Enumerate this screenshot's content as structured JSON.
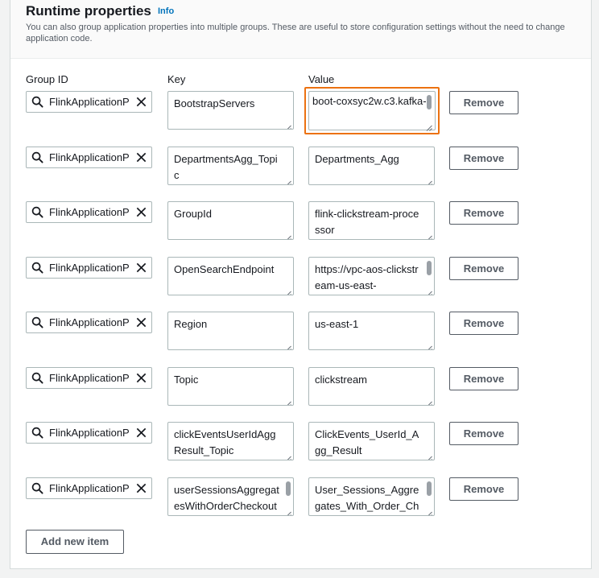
{
  "section": {
    "title": "Runtime properties",
    "info_label": "Info",
    "description": "You can also group application properties into multiple groups. These are useful to store configuration settings without the need to change application code."
  },
  "columns": {
    "group_id": "Group ID",
    "key": "Key",
    "value": "Value"
  },
  "rows": [
    {
      "group": "FlinkApplicationProperties",
      "key": "BootstrapServers",
      "value": "boot-coxsyc2w.c3.kafka-",
      "focused": true,
      "value_scroll": true,
      "key_scroll": false
    },
    {
      "group": "FlinkApplicationProperties",
      "key": "DepartmentsAgg_Topic",
      "value": "Departments_Agg",
      "focused": false,
      "value_scroll": false,
      "key_scroll": false
    },
    {
      "group": "FlinkApplicationProperties",
      "key": "GroupId",
      "value": "flink-clickstream-processor",
      "focused": false,
      "value_scroll": false,
      "key_scroll": false
    },
    {
      "group": "FlinkApplicationProperties",
      "key": "OpenSearchEndpoint",
      "value": "https://vpc-aos-clickstream-us-east-",
      "focused": false,
      "value_scroll": true,
      "key_scroll": false
    },
    {
      "group": "FlinkApplicationProperties",
      "key": "Region",
      "value": "us-east-1",
      "focused": false,
      "value_scroll": false,
      "key_scroll": false
    },
    {
      "group": "FlinkApplicationProperties",
      "key": "Topic",
      "value": "clickstream",
      "focused": false,
      "value_scroll": false,
      "key_scroll": false
    },
    {
      "group": "FlinkApplicationProperties",
      "key": "clickEventsUserIdAggResult_Topic",
      "value": "ClickEvents_UserId_Agg_Result",
      "focused": false,
      "value_scroll": false,
      "key_scroll": false
    },
    {
      "group": "FlinkApplicationProperties",
      "key": "userSessionsAggregatesWithOrderCheckout",
      "value": "User_Sessions_Aggregates_With_Order_Ch",
      "focused": false,
      "value_scroll": true,
      "key_scroll": true
    }
  ],
  "remove_label": "Remove",
  "add_label": "Add new item",
  "colors": {
    "focus": "#ec7211",
    "info": "#0073bb"
  }
}
